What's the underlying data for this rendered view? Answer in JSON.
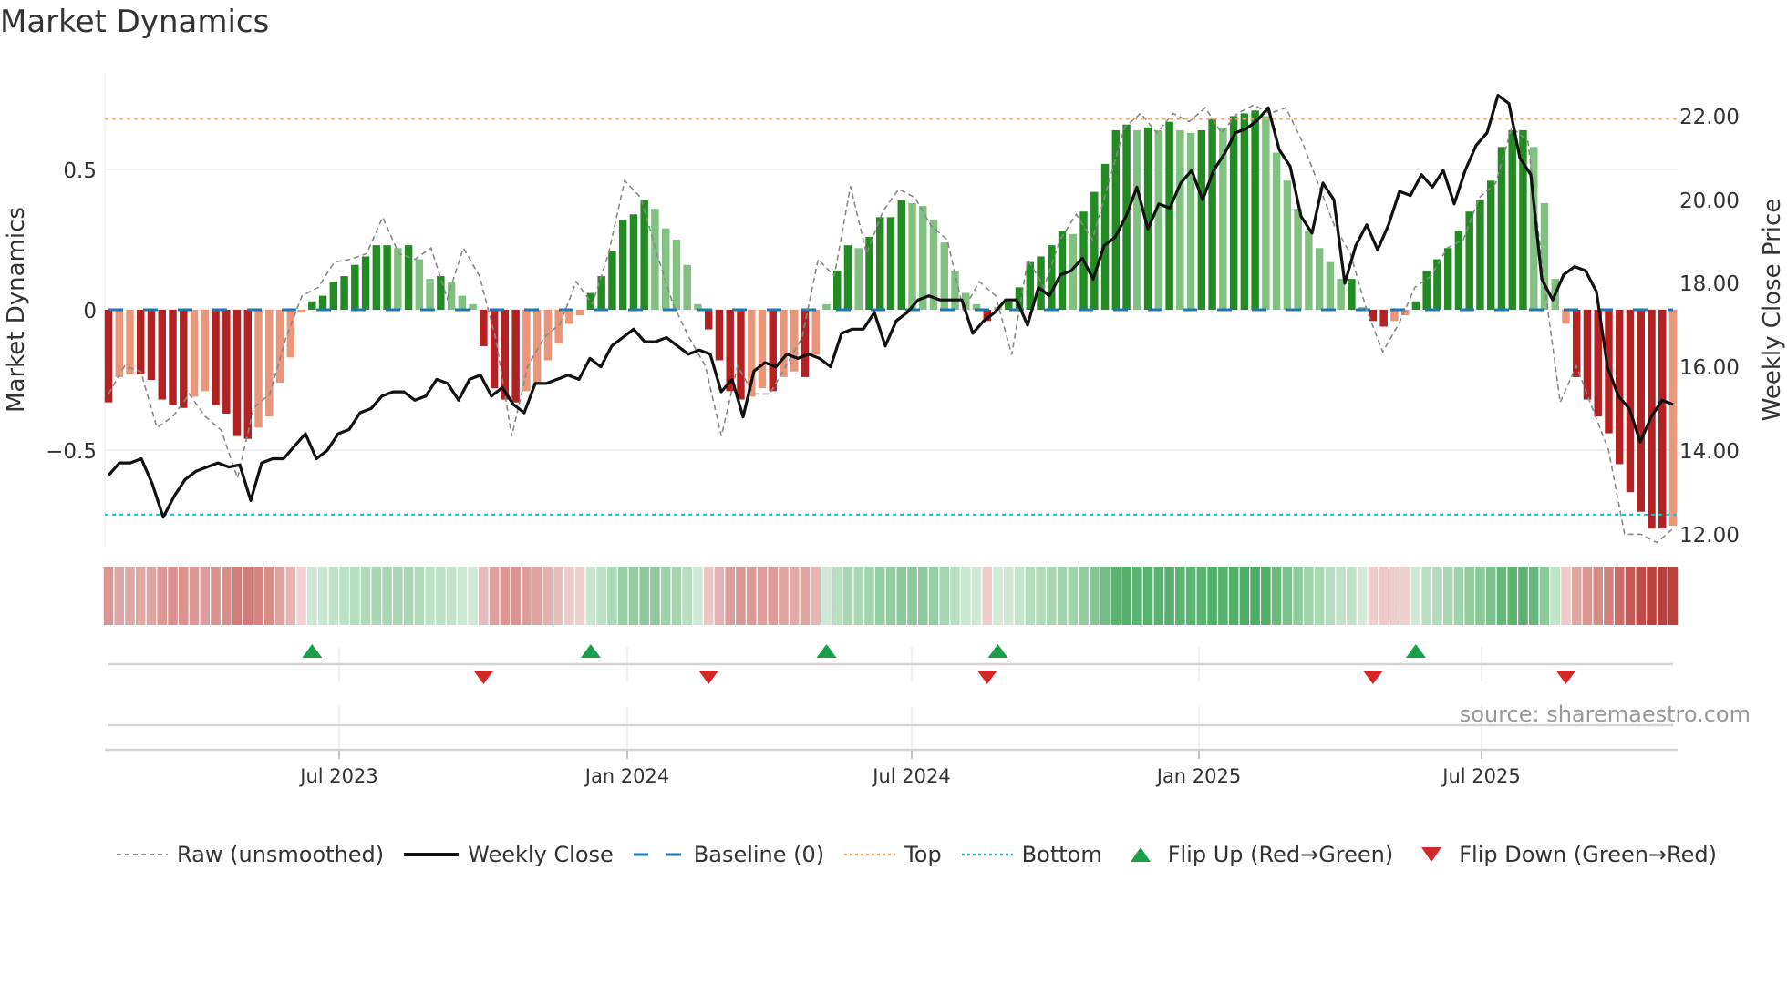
{
  "title": "Market Dynamics",
  "source": "source: sharemaestro.com",
  "chart_data": {
    "type": "bar",
    "title": "Market Dynamics",
    "ylabel": "Market Dynamics",
    "y2label": "Weekly Close Price",
    "ylim": [
      -0.85,
      0.85
    ],
    "y2lim": [
      11.8,
      23.4
    ],
    "yticks": [
      "0.5",
      "0",
      "−0.5"
    ],
    "yticks_values": [
      0.5,
      0,
      -0.5
    ],
    "y2ticks": [
      "22.00",
      "20.00",
      "18.00",
      "16.00",
      "14.00",
      "12.00"
    ],
    "y2ticks_values": [
      22,
      20,
      18,
      16,
      14,
      12
    ],
    "xticks": [
      "Jul 2023",
      "Jan 2024",
      "Jul 2024",
      "Jan 2025",
      "Jul 2025"
    ],
    "top_level": 0.68,
    "bottom_level": -0.73,
    "baseline": 0,
    "momentum": [
      -0.33,
      -0.24,
      -0.23,
      -0.23,
      -0.25,
      -0.32,
      -0.34,
      -0.35,
      -0.31,
      -0.29,
      -0.34,
      -0.37,
      -0.45,
      -0.46,
      -0.42,
      -0.38,
      -0.26,
      -0.17,
      -0.01,
      0.03,
      0.05,
      0.1,
      0.12,
      0.16,
      0.19,
      0.23,
      0.23,
      0.22,
      0.23,
      0.18,
      0.11,
      0.12,
      0.1,
      0.05,
      0.02,
      -0.13,
      -0.28,
      -0.32,
      -0.33,
      -0.29,
      -0.26,
      -0.18,
      -0.12,
      -0.05,
      -0.02,
      0.06,
      0.12,
      0.21,
      0.32,
      0.34,
      0.39,
      0.36,
      0.29,
      0.25,
      0.16,
      0.02,
      -0.07,
      -0.18,
      -0.29,
      -0.32,
      -0.31,
      -0.28,
      -0.29,
      -0.24,
      -0.22,
      -0.24,
      -0.16,
      0.02,
      0.14,
      0.23,
      0.22,
      0.26,
      0.33,
      0.33,
      0.39,
      0.38,
      0.37,
      0.32,
      0.24,
      0.14,
      0.06,
      0.02,
      -0.04,
      0.01,
      0.03,
      0.08,
      0.17,
      0.19,
      0.23,
      0.28,
      0.27,
      0.35,
      0.42,
      0.52,
      0.64,
      0.66,
      0.64,
      0.65,
      0.64,
      0.67,
      0.64,
      0.63,
      0.64,
      0.68,
      0.65,
      0.69,
      0.7,
      0.71,
      0.69,
      0.56,
      0.46,
      0.36,
      0.28,
      0.22,
      0.17,
      0.11,
      0.11,
      0.01,
      -0.04,
      -0.06,
      -0.04,
      -0.02,
      0.03,
      0.14,
      0.18,
      0.22,
      0.28,
      0.35,
      0.39,
      0.46,
      0.58,
      0.64,
      0.64,
      0.58,
      0.38,
      0.11,
      -0.05,
      -0.24,
      -0.32,
      -0.38,
      -0.44,
      -0.55,
      -0.65,
      -0.72,
      -0.78,
      -0.78,
      -0.77
    ],
    "raw": [
      -0.3,
      -0.2,
      -0.22,
      -0.42,
      -0.38,
      -0.3,
      -0.38,
      -0.43,
      -0.6,
      -0.35,
      -0.3,
      -0.1,
      0.05,
      0.08,
      0.17,
      0.18,
      0.2,
      0.33,
      0.2,
      0.18,
      0.22,
      0.04,
      0.22,
      0.12,
      -0.1,
      -0.45,
      -0.2,
      -0.1,
      -0.05,
      0.1,
      0.02,
      0.2,
      0.46,
      0.4,
      0.2,
      0.02,
      -0.1,
      -0.2,
      -0.45,
      -0.2,
      -0.3,
      -0.3,
      -0.2,
      -0.1,
      0.18,
      0.12,
      0.44,
      0.2,
      0.35,
      0.43,
      0.4,
      0.3,
      0.25,
      0.0,
      0.1,
      0.05,
      -0.16,
      0.18,
      0.08,
      0.25,
      0.34,
      0.25,
      0.45,
      0.65,
      0.7,
      0.63,
      0.7,
      0.67,
      0.72,
      0.63,
      0.7,
      0.73,
      0.7,
      0.72,
      0.6,
      0.45,
      0.3,
      0.2,
      0.0,
      -0.15,
      -0.05,
      0.08,
      0.12,
      0.22,
      0.25,
      0.4,
      0.45,
      0.65,
      0.6,
      0.1,
      -0.33,
      -0.2,
      -0.35,
      -0.5,
      -0.8,
      -0.8,
      -0.83,
      -0.78
    ],
    "weekly_close": [
      13.4,
      13.7,
      13.7,
      13.8,
      13.2,
      12.4,
      12.9,
      13.3,
      13.5,
      13.6,
      13.7,
      13.6,
      13.65,
      12.8,
      13.7,
      13.8,
      13.8,
      14.1,
      14.4,
      13.8,
      14.0,
      14.4,
      14.5,
      14.9,
      15.0,
      15.3,
      15.4,
      15.4,
      15.2,
      15.3,
      15.7,
      15.6,
      15.2,
      15.7,
      15.8,
      15.3,
      15.5,
      15.1,
      14.9,
      15.6,
      15.6,
      15.7,
      15.8,
      15.7,
      16.2,
      16.0,
      16.5,
      16.7,
      16.9,
      16.6,
      16.6,
      16.7,
      16.5,
      16.3,
      16.4,
      16.3,
      15.4,
      15.7,
      14.8,
      15.9,
      16.1,
      16.0,
      16.3,
      16.2,
      16.3,
      16.2,
      16.0,
      16.8,
      16.9,
      16.9,
      17.3,
      16.5,
      17.1,
      17.3,
      17.6,
      17.7,
      17.6,
      17.6,
      17.6,
      16.8,
      17.1,
      17.3,
      17.6,
      17.6,
      17.0,
      17.9,
      17.7,
      18.2,
      18.3,
      18.6,
      18.1,
      18.9,
      19.1,
      19.6,
      20.3,
      19.3,
      19.9,
      19.8,
      20.4,
      20.7,
      20.0,
      20.7,
      21.1,
      21.6,
      21.7,
      21.9,
      22.2,
      21.2,
      20.8,
      19.6,
      19.2,
      20.4,
      20.0,
      18.0,
      18.9,
      19.4,
      18.8,
      19.4,
      20.2,
      20.1,
      20.6,
      20.3,
      20.7,
      19.9,
      20.7,
      21.3,
      21.6,
      22.5,
      22.3,
      21.0,
      20.6,
      18.1,
      17.6,
      18.2,
      18.4,
      18.3,
      17.8,
      16.0,
      15.3,
      15.0,
      14.2,
      14.8,
      15.2,
      15.1
    ],
    "colors": {
      "rising_green": "#228b22",
      "falling_green": "#80c080",
      "falling_red": "#b22222",
      "recovering_red": "#e9967a",
      "top": "#f0a868",
      "bottom": "#17becf",
      "baseline": "#1f77b4",
      "raw": "#888888",
      "close": "#111111",
      "flip_up": "#1a9e4a",
      "flip_down": "#d62728"
    },
    "legend": [
      "Raw (unsmoothed)",
      "Weekly Close",
      "Baseline (0)",
      "Top",
      "Bottom",
      "Flip Up (Red→Green)",
      "Flip Down (Green→Red)"
    ],
    "legend_placement": "bottom"
  }
}
